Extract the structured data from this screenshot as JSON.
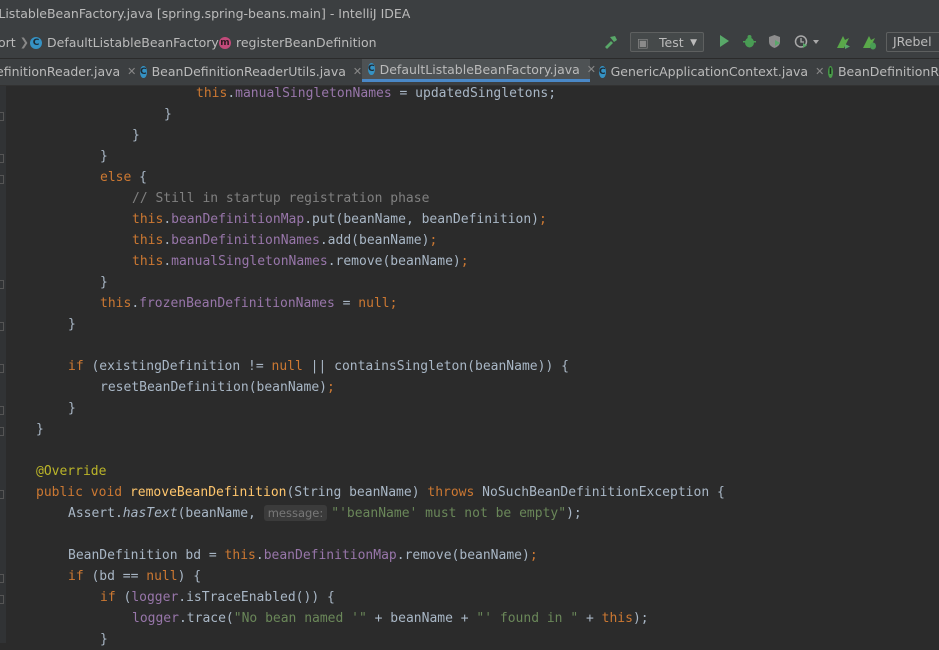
{
  "window": {
    "title": "ltListableBeanFactory.java [spring.spring-beans.main] - IntelliJ IDEA"
  },
  "breadcrumb": [
    {
      "label": "ort",
      "icon": "none"
    },
    {
      "label": "DefaultListableBeanFactory",
      "icon": "class-icon"
    },
    {
      "label": "registerBeanDefinition",
      "icon": "method-icon"
    }
  ],
  "toolbar": {
    "run_config": "Test",
    "jrebel": "JRebel",
    "colors": {
      "run": "#59a869",
      "debug": "#499c54",
      "build": "#499c54"
    }
  },
  "tabs": [
    {
      "label": "efinitionReader.java",
      "icon": "none",
      "active": false
    },
    {
      "label": "BeanDefinitionReaderUtils.java",
      "icon": "class-icon",
      "active": false
    },
    {
      "label": "DefaultListableBeanFactory.java",
      "icon": "class-icon",
      "active": true
    },
    {
      "label": "GenericApplicationContext.java",
      "icon": "class-icon",
      "active": false
    },
    {
      "label": "BeanDefinitionR",
      "icon": "interface-icon",
      "active": false
    }
  ],
  "code": {
    "l1": {
      "a": "this",
      "b": ".",
      "c": "manualSingletonNames",
      "d": " = updatedSingletons;"
    },
    "l2": "}",
    "l3": "}",
    "l4": "}",
    "l5": {
      "kw": "else",
      "rest": " {"
    },
    "l6": "// Still in startup registration phase",
    "l7": {
      "a": "this",
      "b": ".",
      "c": "beanDefinitionMap",
      "d": ".put(beanName, beanDefinition)",
      "e": ";"
    },
    "l8": {
      "a": "this",
      "b": ".",
      "c": "beanDefinitionNames",
      "d": ".add(beanName)",
      "e": ";"
    },
    "l9": {
      "a": "this",
      "b": ".",
      "c": "manualSingletonNames",
      "d": ".remove(beanName)",
      "e": ";"
    },
    "l10": "}",
    "l11": {
      "a": "this",
      "b": ".",
      "c": "frozenBeanDefinitionNames",
      "d": " = ",
      "e": "null",
      "f": ";"
    },
    "l12": "}",
    "l13": {
      "a": "if",
      "b": " (existingDefinition != ",
      "c": "null",
      "d": " || containsSingleton(beanName)) {"
    },
    "l14": {
      "a": "resetBeanDefinition(beanName)",
      "b": ";"
    },
    "l15": "}",
    "l16": "}",
    "l17": "@Override",
    "l18": {
      "a": "public",
      "b": " ",
      "c": "void",
      "d": " ",
      "e": "removeBeanDefinition",
      "f": "(String beanName) ",
      "g": "throws",
      "h": " NoSuchBeanDefinitionException {"
    },
    "l19": {
      "a": "Assert.",
      "b": "hasText",
      "c": "(beanName, ",
      "hint": "message:",
      "d": "\"'beanName' must not be empty\"",
      "e": ");"
    },
    "l20": {
      "a": "BeanDefinition bd = ",
      "b": "this",
      "c": ".",
      "d": "beanDefinitionMap",
      "e": ".remove(beanName)",
      "f": ";"
    },
    "l21": {
      "a": "if",
      "b": " (bd == ",
      "c": "null",
      "d": ") {"
    },
    "l22": {
      "a": "if",
      "b": " (",
      "c": "logger",
      "d": ".isTraceEnabled()) {"
    },
    "l23": {
      "a": "logger",
      "b": ".trace(",
      "c": "\"No bean named '\"",
      "d": " + beanName + ",
      "e": "\"' found in \"",
      "f": " + ",
      "g": "this",
      "h": ");"
    },
    "l24": "}"
  }
}
